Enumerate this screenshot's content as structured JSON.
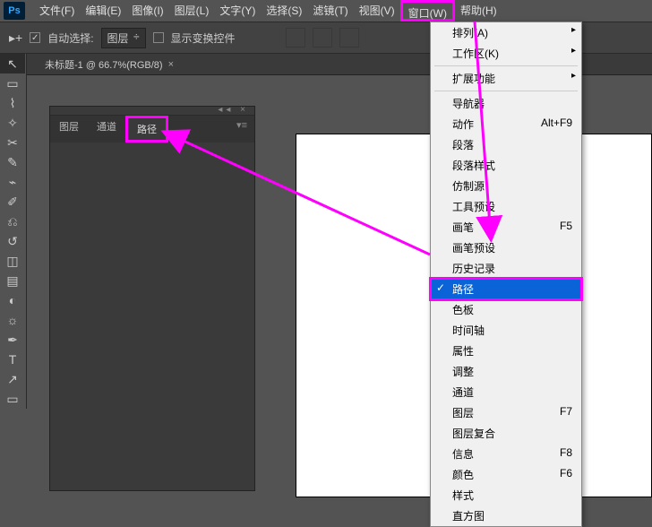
{
  "app": {
    "logo": "Ps"
  },
  "menu": {
    "file": "文件(F)",
    "edit": "编辑(E)",
    "image": "图像(I)",
    "layer": "图层(L)",
    "type": "文字(Y)",
    "select": "选择(S)",
    "filter": "滤镜(T)",
    "view": "视图(V)",
    "window": "窗口(W)",
    "help": "帮助(H)"
  },
  "options": {
    "autoselect": "自动选择:",
    "layer_dd": "图层",
    "caret": "÷",
    "show_transform": "显示变换控件"
  },
  "doc": {
    "title": "未标题-1 @ 66.7%(RGB/8)"
  },
  "panel": {
    "tabs": {
      "layers": "图层",
      "channels": "通道",
      "paths": "路径"
    }
  },
  "dropdown": {
    "arrange": "排列(A)",
    "workspace": "工作区(K)",
    "extensions": "扩展功能",
    "navigator": "导航器",
    "actions": "动作",
    "actions_key": "Alt+F9",
    "paragraph": "段落",
    "para_styles": "段落样式",
    "clone": "仿制源",
    "tool_presets": "工具预设",
    "brush": "画笔",
    "brush_key": "F5",
    "brush_presets": "画笔预设",
    "history": "历史记录",
    "paths": "路径",
    "swatch": "色板",
    "timeline": "时间轴",
    "properties": "属性",
    "adjust": "调整",
    "channels": "通道",
    "layers": "图层",
    "layers_key": "F7",
    "layer_comps": "图层复合",
    "info": "信息",
    "info_key": "F8",
    "color": "颜色",
    "color_key": "F6",
    "styles": "样式",
    "histogram": "直方图"
  },
  "icons": {
    "check": "✓"
  }
}
